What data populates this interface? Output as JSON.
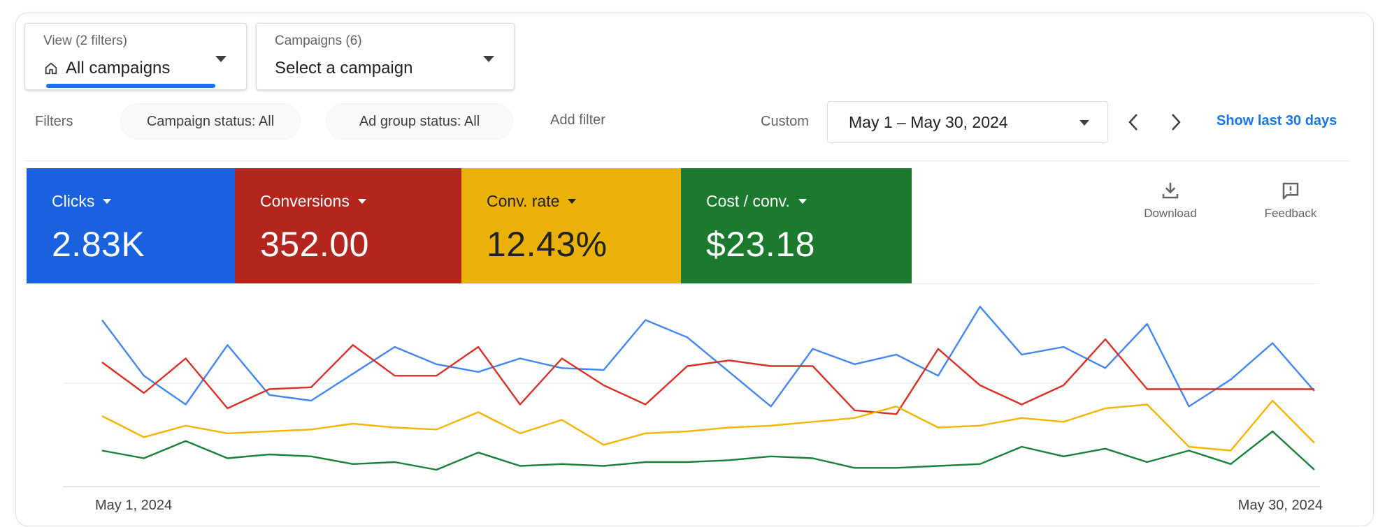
{
  "header": {
    "view": {
      "sub": "View (2 filters)",
      "label": "All campaigns",
      "icon": "home-icon"
    },
    "campaigns": {
      "sub": "Campaigns (6)",
      "label": "Select a campaign"
    }
  },
  "filters": {
    "label": "Filters",
    "chips": [
      "Campaign status: All",
      "Ad group status: All"
    ],
    "add_filter": "Add filter",
    "custom_label": "Custom",
    "date_range": "May 1 – May 30, 2024",
    "show_last": "Show last 30 days"
  },
  "metrics": [
    {
      "label": "Clicks",
      "value": "2.83K",
      "color": "#1a61e0"
    },
    {
      "label": "Conversions",
      "value": "352.00",
      "color": "#b3261e"
    },
    {
      "label": "Conv. rate",
      "value": "12.43%",
      "color": "#eab10a"
    },
    {
      "label": "Cost / conv.",
      "value": "$23.18",
      "color": "#1b7a2e"
    }
  ],
  "tools": {
    "download": "Download",
    "feedback": "Feedback"
  },
  "chart_data": {
    "type": "line",
    "x": [
      "May 1",
      "May 2",
      "May 3",
      "May 4",
      "May 5",
      "May 6",
      "May 7",
      "May 8",
      "May 9",
      "May 10",
      "May 11",
      "May 12",
      "May 13",
      "May 14",
      "May 15",
      "May 16",
      "May 17",
      "May 18",
      "May 19",
      "May 20",
      "May 21",
      "May 22",
      "May 23",
      "May 24",
      "May 25",
      "May 26",
      "May 27",
      "May 28",
      "May 29",
      "May 30"
    ],
    "xlabels": [
      "May 1, 2024",
      "May 30, 2024"
    ],
    "ylim": [
      0,
      1
    ],
    "grid": true,
    "series": [
      {
        "color": "#4285f4",
        "values": [
          0.86,
          0.57,
          0.42,
          0.73,
          0.47,
          0.44,
          0.58,
          0.72,
          0.63,
          0.59,
          0.66,
          0.61,
          0.6,
          0.86,
          0.77,
          0.59,
          0.41,
          0.71,
          0.63,
          0.68,
          0.57,
          0.93,
          0.68,
          0.72,
          0.61,
          0.84,
          0.41,
          0.55,
          0.74,
          0.49
        ]
      },
      {
        "color": "#d93025",
        "values": [
          0.64,
          0.48,
          0.66,
          0.4,
          0.5,
          0.51,
          0.73,
          0.57,
          0.57,
          0.72,
          0.42,
          0.66,
          0.52,
          0.42,
          0.62,
          0.65,
          0.62,
          0.62,
          0.39,
          0.37,
          0.71,
          0.52,
          0.42,
          0.52,
          0.76,
          0.5,
          0.5,
          0.5,
          0.5,
          0.5
        ]
      },
      {
        "color": "#f4b400",
        "values": [
          0.36,
          0.25,
          0.31,
          0.27,
          0.28,
          0.29,
          0.32,
          0.3,
          0.29,
          0.38,
          0.27,
          0.34,
          0.21,
          0.27,
          0.28,
          0.3,
          0.31,
          0.33,
          0.35,
          0.41,
          0.3,
          0.31,
          0.35,
          0.33,
          0.4,
          0.42,
          0.2,
          0.18,
          0.44,
          0.22
        ]
      },
      {
        "color": "#188038",
        "values": [
          0.18,
          0.14,
          0.23,
          0.14,
          0.16,
          0.15,
          0.11,
          0.12,
          0.08,
          0.17,
          0.1,
          0.11,
          0.1,
          0.12,
          0.12,
          0.13,
          0.15,
          0.14,
          0.09,
          0.09,
          0.1,
          0.11,
          0.2,
          0.15,
          0.19,
          0.12,
          0.18,
          0.11,
          0.28,
          0.08
        ]
      }
    ]
  }
}
